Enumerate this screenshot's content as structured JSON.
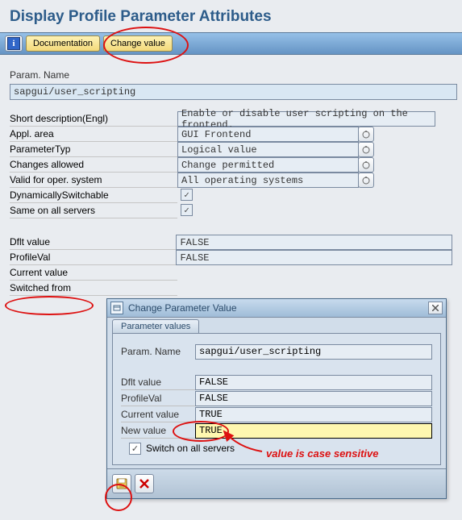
{
  "header": "Display Profile Parameter Attributes",
  "toolbar": {
    "documentation": "Documentation",
    "change_value": "Change value"
  },
  "param_name_label": "Param. Name",
  "param_name_value": "sapgui/user_scripting",
  "details": {
    "short_desc_label": "Short description(Engl)",
    "short_desc_value": "Enable or disable user scripting on the frontend.",
    "appl_area_label": "Appl. area",
    "appl_area_value": "GUI Frontend",
    "param_typ_label": "ParameterTyp",
    "param_typ_value": "Logical value",
    "changes_allowed_label": "Changes allowed",
    "changes_allowed_value": "Change permitted",
    "valid_os_label": "Valid for oper. system",
    "valid_os_value": "All operating systems",
    "dyn_switch_label": "DynamicallySwitchable",
    "same_servers_label": "Same on all servers"
  },
  "values": {
    "dflt_label": "Dflt value",
    "dflt_value": "FALSE",
    "profile_label": "ProfileVal",
    "profile_value": "FALSE",
    "current_label": "Current value",
    "switched_label": "Switched from"
  },
  "dialog": {
    "title": "Change Parameter Value",
    "tab": "Parameter values",
    "param_name_label": "Param. Name",
    "param_name_value": "sapgui/user_scripting",
    "dflt_label": "Dflt value",
    "dflt_value": "FALSE",
    "profile_label": "ProfileVal",
    "profile_value": "FALSE",
    "current_label": "Current value",
    "current_value": "TRUE",
    "new_label": "New value",
    "new_value": "TRUE",
    "switch_all_label": "Switch on all servers"
  },
  "annotation": "value is case sensitive"
}
